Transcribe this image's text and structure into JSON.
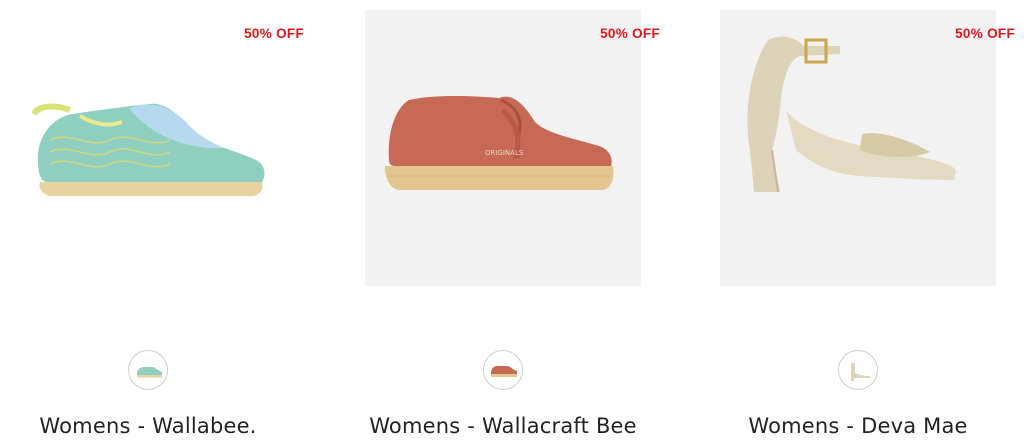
{
  "products": [
    {
      "badge": "50% OFF",
      "name": "Womens - Wallabee.",
      "image": "wallabee-shoe-icon",
      "swatch": "wallabee-swatch-icon",
      "colors": {
        "upper": "#8ecfc0",
        "accent": "#d9e37a",
        "sole": "#e8d3a0"
      }
    },
    {
      "badge": "50% OFF",
      "name": "Womens - Wallacraft Bee",
      "image": "wallacraft-shoe-icon",
      "swatch": "wallacraft-swatch-icon",
      "colors": {
        "upper": "#c66a55",
        "accent": "#b85a47",
        "sole": "#e3c58f"
      }
    },
    {
      "badge": "50% OFF",
      "name": "Womens - Deva Mae",
      "image": "sandal-icon",
      "swatch": "sandal-swatch-icon",
      "colors": {
        "upper": "#ddd3b8",
        "accent": "#c9ba8f",
        "sole": "#d8cdb0"
      }
    }
  ],
  "theme": {
    "badge_color": "#e4141b",
    "placeholder_bg": "#f2f2f2"
  }
}
